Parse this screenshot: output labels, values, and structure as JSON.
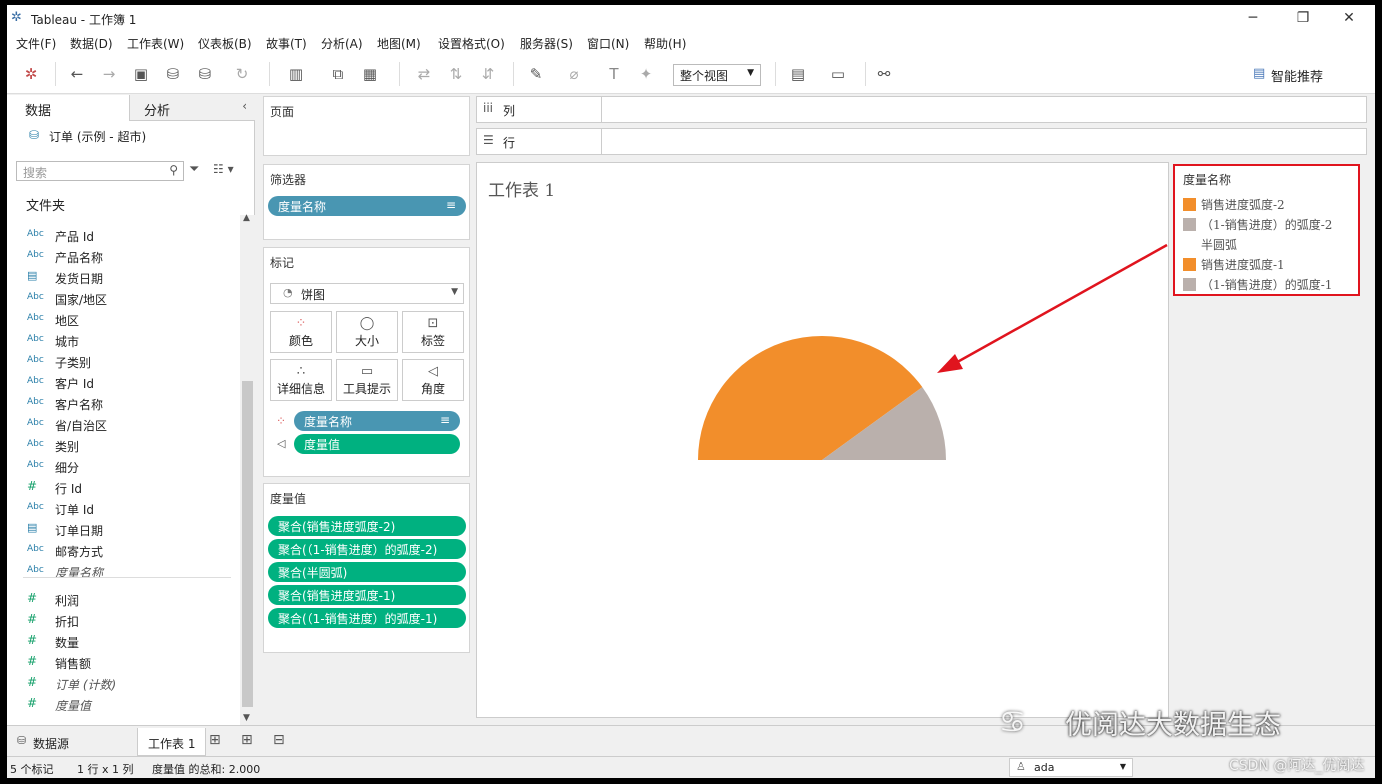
{
  "app": {
    "title": "Tableau - 工作簿 1"
  },
  "menu": [
    "文件(F)",
    "数据(D)",
    "工作表(W)",
    "仪表板(B)",
    "故事(T)",
    "分析(A)",
    "地图(M)",
    "设置格式(O)",
    "服务器(S)",
    "窗口(N)",
    "帮助(H)"
  ],
  "toolbar": {
    "fit": "整个视图",
    "smart": "智能推荐"
  },
  "left_panel": {
    "tab_data": "数据",
    "tab_analysis": "分析",
    "datasource": "订单 (示例 - 超市)",
    "search_placeholder": "搜索",
    "folder": "文件夹",
    "dimensions": [
      {
        "icon": "Abc",
        "name": "产品 Id"
      },
      {
        "icon": "Abc",
        "name": "产品名称"
      },
      {
        "icon": "date",
        "name": "发货日期"
      },
      {
        "icon": "Abc",
        "name": "国家/地区"
      },
      {
        "icon": "Abc",
        "name": "地区"
      },
      {
        "icon": "Abc",
        "name": "城市"
      },
      {
        "icon": "Abc",
        "name": "子类别"
      },
      {
        "icon": "Abc",
        "name": "客户 Id"
      },
      {
        "icon": "Abc",
        "name": "客户名称"
      },
      {
        "icon": "Abc",
        "name": "省/自治区"
      },
      {
        "icon": "Abc",
        "name": "类别"
      },
      {
        "icon": "Abc",
        "name": "细分"
      },
      {
        "icon": "#",
        "name": "行 Id"
      },
      {
        "icon": "Abc",
        "name": "订单 Id"
      },
      {
        "icon": "date",
        "name": "订单日期"
      },
      {
        "icon": "Abc",
        "name": "邮寄方式"
      },
      {
        "icon": "Abc",
        "name": "度量名称",
        "italic": true
      }
    ],
    "measures": [
      {
        "name": "利润"
      },
      {
        "name": "折扣"
      },
      {
        "name": "数量"
      },
      {
        "name": "销售额"
      },
      {
        "name": "订单 (计数)",
        "italic": true
      },
      {
        "name": "度量值",
        "italic": true
      }
    ]
  },
  "cards": {
    "pages": "页面",
    "filters": "筛选器",
    "filter_pill": "度量名称",
    "marks": "标记",
    "mark_type": "饼图",
    "mark_buttons": [
      "颜色",
      "大小",
      "标签",
      "详细信息",
      "工具提示",
      "角度"
    ],
    "mark_pills": [
      "度量名称",
      "度量值"
    ],
    "measure_values": "度量值",
    "measure_pills": [
      "聚合(销售进度弧度-2)",
      "聚合(（1-销售进度）的弧度-2)",
      "聚合(半圆弧)",
      "聚合(销售进度弧度-1)",
      "聚合(（1-销售进度）的弧度-1)"
    ]
  },
  "shelves": {
    "columns": "列",
    "rows": "行"
  },
  "sheet": {
    "title": "工作表 1"
  },
  "legend": {
    "title": "度量名称",
    "items": [
      {
        "label": "销售进度弧度-2",
        "color": "#f28e2b"
      },
      {
        "label": "（1-销售进度）的弧度-2",
        "color": "#bab0ac"
      },
      {
        "label": "半圆弧",
        "color": ""
      },
      {
        "label": "销售进度弧度-1",
        "color": "#f28e2b"
      },
      {
        "label": "（1-销售进度）的弧度-1",
        "color": "#bab0ac"
      }
    ]
  },
  "chart_data": {
    "type": "pie",
    "shape": "semicircle",
    "categories": [
      "销售进度弧度-2",
      "（1-销售进度）的弧度-2"
    ],
    "values": [
      0.8,
      0.2
    ],
    "colors": [
      "#f28e2b",
      "#bab0ac"
    ]
  },
  "bottom_tabs": {
    "datasource": "数据源",
    "sheet": "工作表 1"
  },
  "status": {
    "marks": "5 个标记",
    "rowcol": "1 行 x 1 列",
    "sum": "度量值 的总和: 2.000",
    "user": "ada"
  },
  "watermark": {
    "main": "优阅达大数据生态",
    "csdn": "CSDN @阿达_优阅达"
  }
}
